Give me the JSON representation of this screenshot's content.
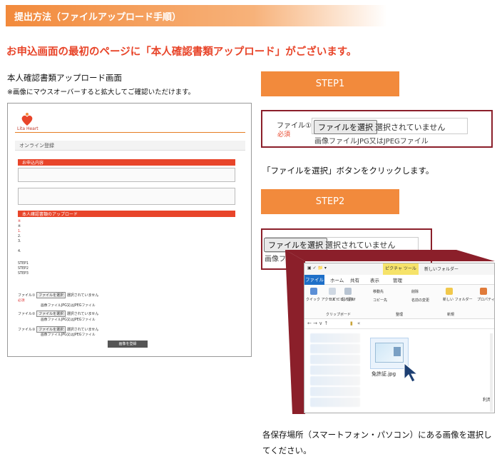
{
  "section": {
    "title": "提出方法（ファイルアップロード手順）"
  },
  "headline": "お申込画面の最初のページに「本人確認書類アップロード」がございます。",
  "left": {
    "title": "本人確認書類アップロード画面",
    "subtitle": "※画像にマウスオーバーすると拡大してご確認いただけます。",
    "mock": {
      "logo_text": "Lita Heart",
      "online_label": "オンライン登録",
      "order_header": "お申込内容",
      "upload_header": "本人確認書類のアップロード",
      "file_button": "ファイルを選択",
      "file_status": "選択されていません",
      "file_hint": "画像ファイルJPG又はJPEGファイル",
      "file1_label": "ファイル①",
      "file2_label": "ファイル②",
      "file3_label": "ファイル③",
      "required": "必須",
      "submit": "画像を登録"
    }
  },
  "step1": {
    "label": "STEP1",
    "file_label": "ファイル①",
    "required": "必須",
    "button": "ファイルを選択",
    "status": "選択されていません",
    "hint": "画像ファイルJPG又はJPEGファイル",
    "instruction": "「ファイルを選択」ボタンをクリックします。"
  },
  "step2": {
    "label": "STEP2",
    "button": "ファイルを選択",
    "status": "選択されていません",
    "truncated_hint": "画像フ",
    "explorer": {
      "picture_tools": "ピクチャ ツール",
      "new_folder": "新しいフォルダー",
      "tab_file": "ファイル",
      "tab_home": "ホーム",
      "tab_share": "共有",
      "tab_view": "表示",
      "tab_manage": "管理",
      "quick_access": "クイック アクセス にピン留め",
      "copy": "コピー",
      "paste": "貼り付け",
      "move_to": "移動先",
      "copy_to": "コピー先",
      "delete": "削除",
      "rename": "名前の変更",
      "new_folder_btn": "新しい フォルダー",
      "properties": "プロパティ",
      "group_clipboard": "クリップボード",
      "group_organize": "整理",
      "group_new": "新規",
      "address": "«",
      "file_name": "免許証.jpg",
      "partial_right": "利用"
    },
    "instruction": "各保存場所（スマートフォン・パソコン）にある画像を選択してください。"
  },
  "colors": {
    "accent": "#f28a3c",
    "headline_red": "#e8452a",
    "frame": "#8b1f2a"
  }
}
